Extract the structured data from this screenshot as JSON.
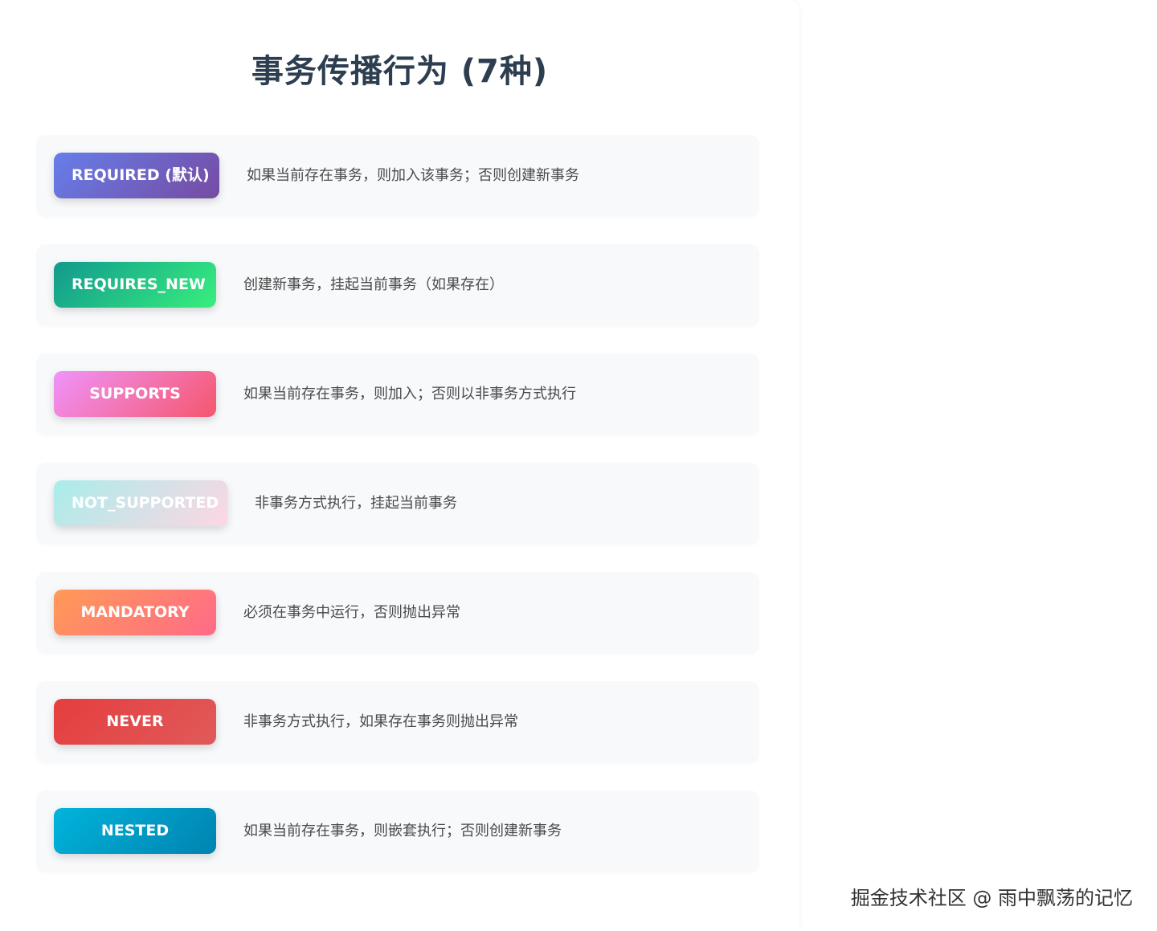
{
  "title": "事务传播行为 (7种)",
  "propagations": [
    {
      "name": "REQUIRED (默认)",
      "description": "如果当前存在事务，则加入该事务；否则创建新事务",
      "gradient": [
        "#667eea",
        "#764ba2"
      ]
    },
    {
      "name": "REQUIRES_NEW",
      "description": "创建新事务，挂起当前事务（如果存在）",
      "gradient": [
        "#11998e",
        "#38ef7d"
      ]
    },
    {
      "name": "SUPPORTS",
      "description": "如果当前存在事务，则加入；否则以非事务方式执行",
      "gradient": [
        "#f093fb",
        "#f5576c"
      ]
    },
    {
      "name": "NOT_SUPPORTED",
      "description": "非事务方式执行，挂起当前事务",
      "gradient": [
        "#a8edea",
        "#fed6e3"
      ]
    },
    {
      "name": "MANDATORY",
      "description": "必须在事务中运行，否则抛出异常",
      "gradient": [
        "#ff9a56",
        "#ff6a88"
      ]
    },
    {
      "name": "NEVER",
      "description": "非事务方式执行，如果存在事务则抛出异常",
      "gradient": [
        "#e53e3e",
        "#e05a5a"
      ]
    },
    {
      "name": "NESTED",
      "description": "如果当前存在事务，则嵌套执行；否则创建新事务",
      "gradient": [
        "#00b4db",
        "#0083b0"
      ]
    }
  ],
  "watermark": "掘金技术社区 @ 雨中飘荡的记忆"
}
